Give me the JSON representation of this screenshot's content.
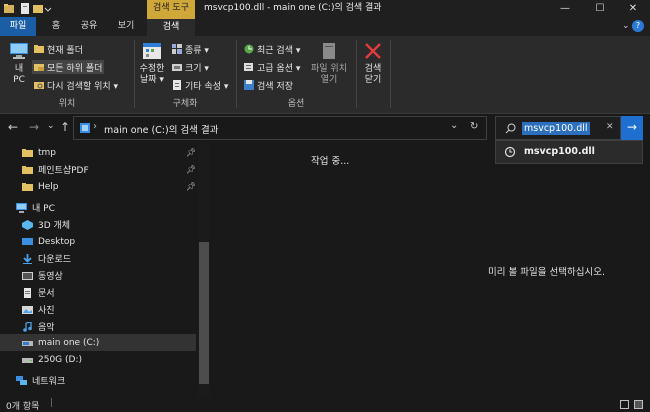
{
  "titlebar": {
    "context_tab_group": "검색 도구",
    "title": "msvcp100.dll - main one (C:)의 검색 결과",
    "minimize": "—",
    "maximize": "☐",
    "close": "✕"
  },
  "tabs": {
    "file": "파일",
    "home": "홈",
    "share": "공유",
    "view": "보기",
    "search": "검색"
  },
  "ribbon": {
    "this_pc_line1": "내",
    "this_pc_line2": "PC",
    "current_folder": "현재 폴더",
    "all_subfolders": "모든 하위 폴더",
    "search_again": "다시 검색할 위치 ▾",
    "location_group": "위치",
    "date_modified_line1": "수정한",
    "date_modified_line2": "날짜 ▾",
    "kind": "종류 ▾",
    "size": "크기 ▾",
    "other_properties": "기타 속성 ▾",
    "refine_group": "구체화",
    "recent_searches": "최근 검색 ▾",
    "advanced_options": "고급 옵션 ▾",
    "save_search": "검색 저장",
    "open_location_line1": "파일 위치",
    "open_location_line2": "열기",
    "options_group": "옵션",
    "close_search_line1": "검색",
    "close_search_line2": "닫기"
  },
  "address": {
    "back": "←",
    "forward": "→",
    "recent": "⌄",
    "up": "↑",
    "breadcrumb_sep": "›",
    "path": "main one (C:)의 검색 결과",
    "dropdown": "⌄",
    "refresh": "↻"
  },
  "search": {
    "query": "msvcp100.dll",
    "clear": "✕",
    "go": "→",
    "suggestion": "msvcp100.dll"
  },
  "nav": {
    "quick": [
      {
        "label": "tmp",
        "pinned": true
      },
      {
        "label": "페인트샵PDF",
        "pinned": true
      },
      {
        "label": "Help",
        "pinned": true
      }
    ],
    "this_pc": "내 PC",
    "pc_items": [
      "3D 개체",
      "Desktop",
      "다운로드",
      "동영상",
      "문서",
      "사진",
      "음악",
      "main one (C:)",
      "250G (D:)"
    ],
    "network": "네트워크"
  },
  "content": {
    "working": "작업 중...",
    "preview": "미리 볼 파일을 선택하십시오."
  },
  "status": {
    "items": "0개 항목"
  },
  "colors": {
    "accent": "#1b5ea6",
    "context": "#d0a83a",
    "background": "#191919",
    "ribbon": "#2b2b2b"
  }
}
